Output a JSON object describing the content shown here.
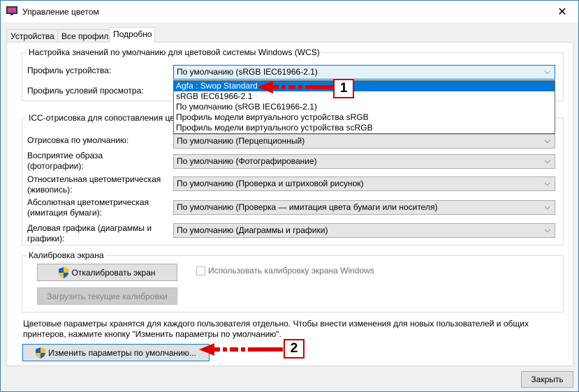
{
  "window": {
    "title": "Управление цветом",
    "close_glyph": "✕"
  },
  "tabs": [
    {
      "label": "Устройства"
    },
    {
      "label": "Все профили"
    },
    {
      "label": "Подробно"
    }
  ],
  "wcs": {
    "title": "Настройка значений по умолчанию для цветовой системы Windows (WCS)",
    "device_profile_label": "Профиль устройства:",
    "viewing_conditions_label": "Профиль условий просмотра:",
    "device_profile_value": "По умолчанию (sRGB IEC61966-2.1)",
    "dropdown_options": [
      "Agfa : Swop Standard",
      "sRGB IEC61966-2.1",
      "По умолчанию (sRGB IEC61966-2.1)",
      "Профиль модели виртуального устройства sRGB",
      "Профиль модели виртуального устройства scRGB"
    ],
    "dropdown_highlighted_index": 0
  },
  "icc": {
    "title": "ICC-отрисовка для сопоставления цве",
    "rows": [
      {
        "label": "Отрисовка по умолчанию:",
        "value": "По умолчанию (Перцепционный)"
      },
      {
        "label": "Восприятие образа\n(фотографии):",
        "value": "По умолчанию (Фотографирование)"
      },
      {
        "label": "Относительная цветометрическая\n(живопись):",
        "value": "По умолчанию (Проверка и штриховой рисунок)"
      },
      {
        "label": "Абсолютная цветометрическая\n(имитация бумаги):",
        "value": "По умолчанию (Проверка — имитация цвета бумаги или носителя)"
      },
      {
        "label": "Деловая графика (диаграммы и\nграфики):",
        "value": "По умолчанию (Диаграммы и графики)"
      }
    ]
  },
  "calibration": {
    "title": "Калибровка экрана",
    "calibrate_button": "Откалибровать экран",
    "load_button": "Загрузить текущие калибровки",
    "use_windows_checkbox": "Использовать калибровку экрана Windows",
    "use_windows_checked": false
  },
  "footer": {
    "note": "Цветовые параметры хранятся для каждого пользователя отдельно. Чтобы внести изменения для новых пользователей и общих принтеров, нажмите кнопку \"Изменить параметры по умолчанию\".",
    "change_defaults_button": "Изменить параметры по умолчанию...",
    "close_button": "Закрыть"
  },
  "annotations": {
    "badge_1": "1",
    "badge_2": "2",
    "color": "#e00000"
  },
  "chevron": "⌵"
}
